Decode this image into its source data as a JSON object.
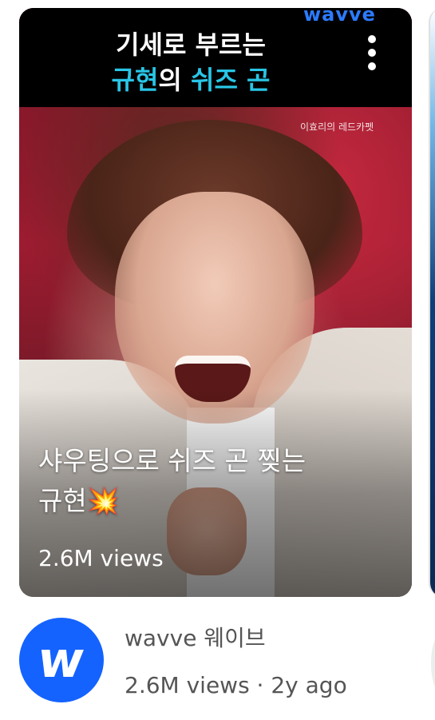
{
  "card": {
    "brand": "wavve",
    "title_line1": "기세로 부르는",
    "title_line2_highlight": "규현",
    "title_line2_rest": "의 ",
    "title_line2_highlight2": "쉬즈 곤",
    "corner_label": "이효리의 레드카펫",
    "caption_line1": "샤우팅으로 쉬즈 곤 찢는",
    "caption_line2": "규현",
    "caption_emoji": "💥",
    "views": "2.6M views",
    "more_icon": "more-vert-icon"
  },
  "channel": {
    "name": "wavve 웨이브",
    "meta": "2.6M views · 2y ago",
    "avatar_letter": "w",
    "avatar_color": "#1463ff"
  },
  "colors": {
    "highlight": "#29c5e6",
    "brand": "#2b7bff"
  }
}
